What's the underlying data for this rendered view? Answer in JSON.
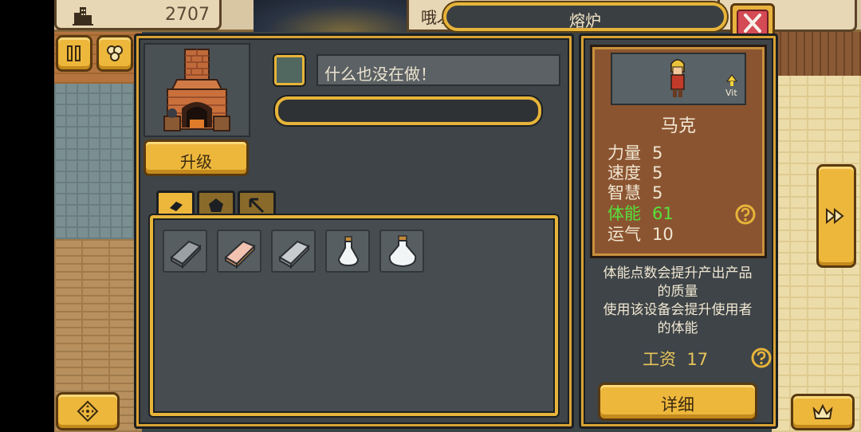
{
  "hud": {
    "coins": "2707",
    "partial_name": "哦ぶ"
  },
  "window": {
    "title": "熔炉"
  },
  "furnace": {
    "upgrade_label": "升级",
    "status_text": "什么也没在做！",
    "progress": 0
  },
  "tabs": [
    {
      "icon": "ingot-icon",
      "active": true
    },
    {
      "icon": "ore-icon",
      "active": false
    },
    {
      "icon": "pickaxe-icon",
      "active": false
    }
  ],
  "inventory": [
    {
      "icon": "iron-ingot-icon"
    },
    {
      "icon": "copper-ingot-icon"
    },
    {
      "icon": "silver-ingot-icon"
    },
    {
      "icon": "small-potion-flask-icon"
    },
    {
      "icon": "large-potion-flask-icon"
    }
  ],
  "worker": {
    "name": "马克",
    "badge": "Vit",
    "stats": [
      {
        "label": "力量",
        "value": "5",
        "highlight": false
      },
      {
        "label": "速度",
        "value": "5",
        "highlight": false
      },
      {
        "label": "智慧",
        "value": "5",
        "highlight": false
      },
      {
        "label": "体能",
        "value": "61",
        "highlight": true
      },
      {
        "label": "运气",
        "value": "10",
        "highlight": false
      }
    ],
    "description_1_line1": "体能点数会提升产出产品",
    "description_1_line2": "的质量",
    "description_2_line1": "使用该设备会提升使用者",
    "description_2_line2": "的体能",
    "wage_label": "工资",
    "wage_value": "17",
    "detail_label": "详细"
  },
  "colors": {
    "gold": "#edb73c",
    "panel": "#3e4447",
    "highlight_stat": "#55e23b",
    "close_red": "#d44a55"
  }
}
